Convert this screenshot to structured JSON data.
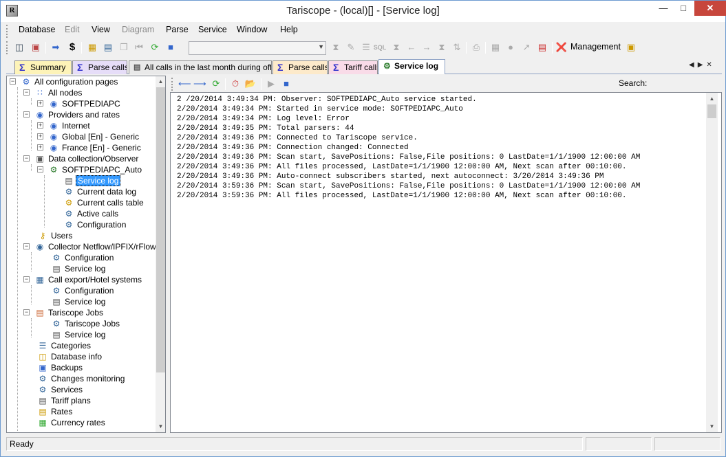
{
  "window": {
    "title": "Tariscope - (local)[] - [Service log]",
    "app_icon_letter": "R"
  },
  "menu": [
    "Database",
    "Edit",
    "View",
    "Diagram",
    "Parse",
    "Service",
    "Window",
    "Help"
  ],
  "toolbar": {
    "combo_value": "",
    "management_label": "Management",
    "dollar_label": "$",
    "sql_label": "SQL"
  },
  "tabs": [
    {
      "label": "Summary"
    },
    {
      "label": "Parse calls"
    },
    {
      "label": "All calls in the last month during off-h"
    },
    {
      "label": "Parse calls"
    },
    {
      "label": "Tariff calls"
    },
    {
      "label": "Service log"
    }
  ],
  "tree": {
    "root": "All configuration pages",
    "all_nodes": "All nodes",
    "softpediapc": "SOFTPEDIAPC",
    "providers": "Providers and rates",
    "internet": "Internet",
    "global_generic": "Global [En] - Generic",
    "france_generic": "France [En] - Generic",
    "data_collection": "Data collection/Observer",
    "softpediapc_auto": "SOFTPEDIAPC_Auto",
    "service_log": "Service log",
    "current_data_log": "Current data log",
    "current_calls_table": "Current calls table",
    "active_calls": "Active calls",
    "configuration": "Configuration",
    "users": "Users",
    "collector": "Collector Netflow/IPFIX/rFlow",
    "call_export": "Call export/Hotel systems",
    "tariscope_jobs": "Tariscope Jobs",
    "tariscope_jobs_child": "Tariscope Jobs",
    "categories": "Categories",
    "database_info": "Database info",
    "backups": "Backups",
    "changes_monitoring": "Changes monitoring",
    "services": "Services",
    "tariff_plans": "Tariff plans",
    "rates": "Rates",
    "currency_rates": "Currency rates"
  },
  "log": {
    "search_label": "Search:",
    "search_value": "",
    "lines": [
      "2 /20/2014 3:49:34 PM: Observer: SOFTPEDIAPC_Auto service started.",
      "2/20/2014 3:49:34 PM: Started in service mode: SOFTPEDIAPC_Auto",
      "2/20/2014 3:49:34 PM: Log level: Error",
      "2/20/2014 3:49:35 PM: Total parsers: 44",
      "2/20/2014 3:49:36 PM: Connected to Tariscope service.",
      "2/20/2014 3:49:36 PM: Connection changed: Connected",
      "2/20/2014 3:49:36 PM: Scan start, SavePositions: False,File positions: 0 LastDate=1/1/1900 12:00:00 AM",
      "2/20/2014 3:49:36 PM: All files processed, LastDate=1/1/1900 12:00:00 AM, Next scan after 00:10:00.",
      "2/20/2014 3:49:36 PM: Auto-connect subscribers started, next autoconnect: 3/20/2014 3:49:36 PM",
      "2/20/2014 3:59:36 PM: Scan start, SavePositions: False,File positions: 0 LastDate=1/1/1900 12:00:00 AM",
      "2/20/2014 3:59:36 PM: All files processed, LastDate=1/1/1900 12:00:00 AM, Next scan after 00:10:00."
    ]
  },
  "status": {
    "text": "Ready"
  }
}
